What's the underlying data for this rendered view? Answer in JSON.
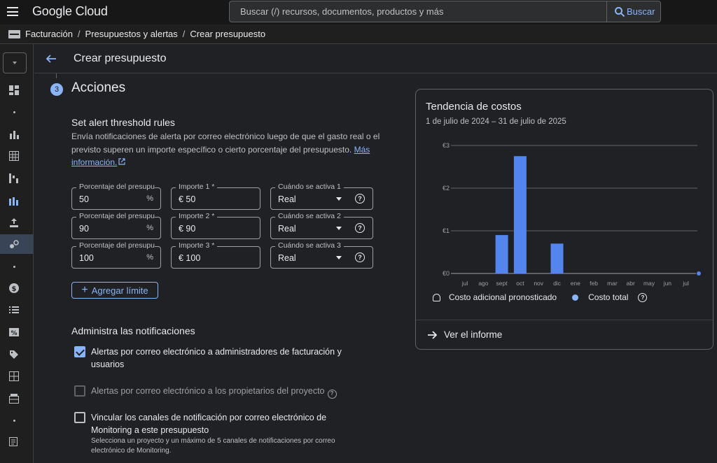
{
  "topbar": {
    "logo": "Google Cloud",
    "search_placeholder": "Buscar (/) recursos, documentos, productos y más",
    "search_button": "Buscar"
  },
  "breadcrumb": [
    "Facturación",
    "Presupuestos y alertas",
    "Crear presupuesto"
  ],
  "header": {
    "title": "Crear presupuesto"
  },
  "step": {
    "number": "3",
    "title": "Acciones"
  },
  "threshold": {
    "title": "Set alert threshold rules",
    "description": "Envía notificaciones de alerta por correo electrónico luego de que el gasto real o el previsto superen un importe específico o cierto porcentaje del presupuesto.",
    "link": "Más información.",
    "rows": [
      {
        "pct_label": "Porcentaje del presupuesto",
        "pct_value": "50",
        "pct_suffix": "%",
        "amt_label": "Importe 1 *",
        "amt_value": "€ 50",
        "trigger_label": "Cuándo se activa 1",
        "trigger_value": "Real"
      },
      {
        "pct_label": "Porcentaje del presupuesto",
        "pct_value": "90",
        "pct_suffix": "%",
        "amt_label": "Importe 2 *",
        "amt_value": "€ 90",
        "trigger_label": "Cuándo se activa 2",
        "trigger_value": "Real"
      },
      {
        "pct_label": "Porcentaje del presupuesto",
        "pct_value": "100",
        "pct_suffix": "%",
        "amt_label": "Importe 3 *",
        "amt_value": "€ 100",
        "trigger_label": "Cuándo se activa 3",
        "trigger_value": "Real"
      }
    ],
    "add_button": "Agregar límite"
  },
  "notifications": {
    "title": "Administra las notificaciones",
    "options": [
      {
        "label": "Alertas por correo electrónico a administradores de facturación y usuarios",
        "checked": true,
        "disabled": false
      },
      {
        "label": "Alertas por correo electrónico a los propietarios del proyecto",
        "checked": false,
        "disabled": true
      },
      {
        "label": "Vincular los canales de notificación por correo electrónico de Monitoring a este presupuesto",
        "checked": false,
        "disabled": false,
        "sublabel": "Selecciona un proyecto y un máximo de 5 canales de notificaciones por correo electrónico de Monitoring."
      }
    ]
  },
  "trend_card": {
    "title": "Tendencia de costos",
    "subtitle": "1 de julio de 2024 – 31 de julio de 2025",
    "legend_forecast": "Costo adicional pronosticado",
    "legend_total": "Costo total",
    "link": "Ver el informe"
  },
  "chart_data": {
    "type": "bar",
    "categories": [
      "jul",
      "ago",
      "sept",
      "oct",
      "nov",
      "dic",
      "ene",
      "feb",
      "mar",
      "abr",
      "may",
      "jun",
      "jul"
    ],
    "values": [
      0,
      0,
      0.9,
      2.75,
      0,
      0.7,
      0,
      0,
      0,
      0,
      0,
      0,
      0
    ],
    "y_ticks": [
      "€0",
      "€1",
      "€2",
      "€3"
    ],
    "ylim": [
      0,
      3
    ],
    "grid": true,
    "bar_color": "#5484ed",
    "legend_placement": "bottom"
  },
  "colors": {
    "accent": "#8ab4f8",
    "background": "#202124",
    "bar": "#5484ed"
  }
}
